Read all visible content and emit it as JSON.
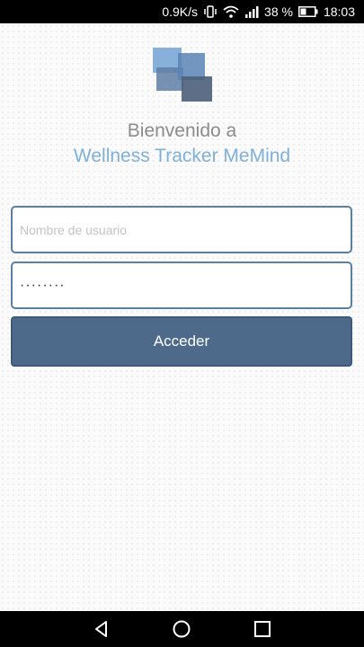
{
  "status_bar": {
    "network_speed": "0.9K/s",
    "battery_percent": "38 %",
    "time": "18:03",
    "icons": [
      "vibrate-icon",
      "wifi-icon",
      "signal-icon",
      "battery-icon"
    ]
  },
  "login": {
    "welcome_text": "Bienvenido a",
    "app_name": "Wellness Tracker MeMind",
    "username_placeholder": "Nombre de usuario",
    "password_value": "········",
    "submit_label": "Acceder"
  },
  "colors": {
    "accent": "#4d6a8a",
    "app_name": "#7fb0d9",
    "field_border": "#5a7fa5"
  },
  "nav_bar": {
    "icons": [
      "back-icon",
      "home-icon",
      "recents-icon"
    ]
  }
}
